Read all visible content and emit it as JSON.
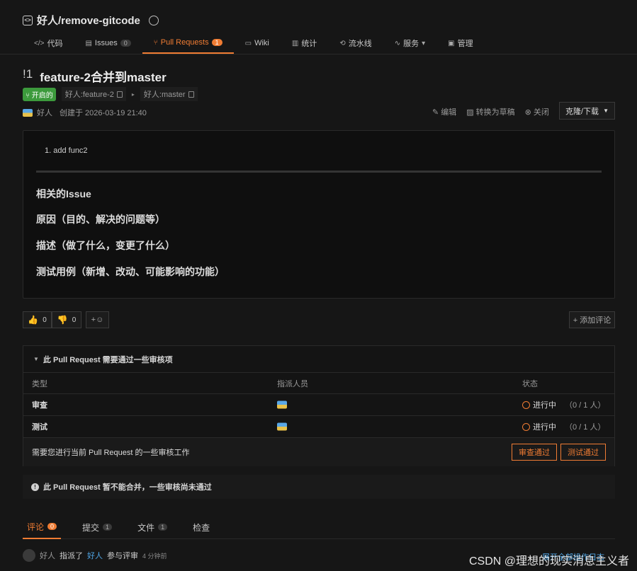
{
  "repo": {
    "path": "好人/remove-gitcode"
  },
  "nav_tabs": [
    {
      "icon": "code-icon",
      "glyph": "</>",
      "label": "代码"
    },
    {
      "icon": "issues-icon",
      "glyph": "▤",
      "label": "Issues",
      "count": "0"
    },
    {
      "icon": "pull-request-icon",
      "glyph": "⑂",
      "label": "Pull Requests",
      "count": "1",
      "active": true
    },
    {
      "icon": "wiki-icon",
      "glyph": "▭",
      "label": "Wiki"
    },
    {
      "icon": "stats-icon",
      "glyph": "▥",
      "label": "统计"
    },
    {
      "icon": "pipeline-icon",
      "glyph": "⟲",
      "label": "流水线"
    },
    {
      "icon": "services-icon",
      "glyph": "∿",
      "label": "服务",
      "dropdown": true
    },
    {
      "icon": "manage-icon",
      "glyph": "▣",
      "label": "管理"
    }
  ],
  "pr": {
    "number": "!1",
    "title": "feature-2合并到master",
    "status": "开启的",
    "source_branch": "好人:feature-2",
    "target_branch": "好人:master",
    "author": "好人",
    "created": "创建于 2026-03-19 21:40"
  },
  "actions": {
    "edit": "编辑",
    "draft": "转换为草稿",
    "close": "关闭",
    "clone": "克隆/下载"
  },
  "description": {
    "list_item": "1. add func2",
    "headings": [
      "相关的Issue",
      "原因（目的、解决的问题等）",
      "描述（做了什么，变更了什么）",
      "测试用例（新增、改动、可能影响的功能）"
    ]
  },
  "reactions": {
    "thumbs_up": "0",
    "thumbs_down": "0",
    "add_reaction": "+☺",
    "add_comment": "+ 添加评论"
  },
  "review": {
    "header": "此 Pull Request 需要通过一些审核项",
    "columns": [
      "类型",
      "指派人员",
      "状态"
    ],
    "rows": [
      {
        "type": "审查",
        "status": "进行中",
        "count": "（0 / 1 人）"
      },
      {
        "type": "测试",
        "status": "进行中",
        "count": "（0 / 1 人）"
      }
    ],
    "footer_text": "需要您进行当前 Pull Request 的一些审核工作",
    "approve_review": "审查通过",
    "approve_test": "测试通过"
  },
  "merge_warning": "此 Pull Request 暂不能合并，一些审核尚未通过",
  "bottom_tabs": [
    {
      "label": "评论",
      "count": "0",
      "active": true
    },
    {
      "label": "提交",
      "count": "1"
    },
    {
      "label": "文件",
      "count": "1"
    },
    {
      "label": "检查"
    }
  ],
  "activity": {
    "user": "好人",
    "verb": "指派了",
    "target": "好人",
    "suffix": "参与评审",
    "time": "4 分钟前",
    "more_link": "展开全部操作日志"
  },
  "watermark": "CSDN @理想的现实消息主义者",
  "colors": {
    "accent": "#f07c33",
    "open_green": "#3c9a3c",
    "link_blue": "#4fa6e6",
    "background": "#161616"
  }
}
